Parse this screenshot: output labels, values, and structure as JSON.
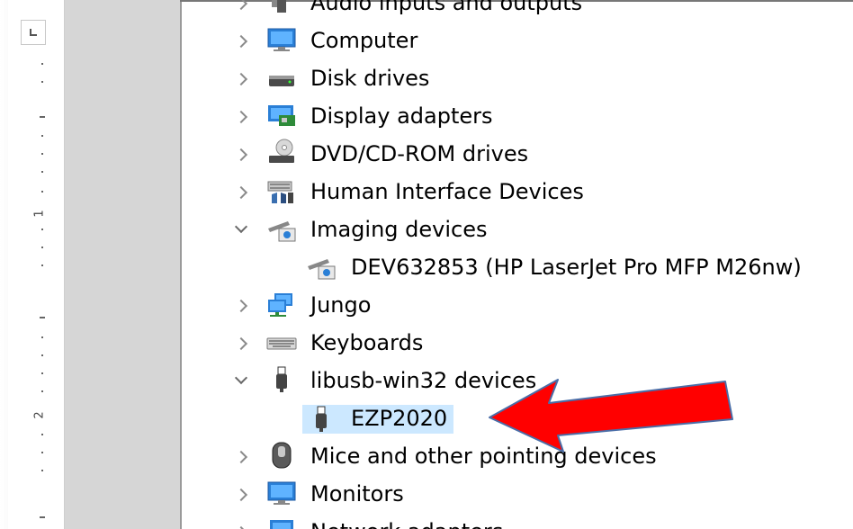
{
  "device_tree": {
    "items": [
      {
        "label": "Audio inputs and outputs",
        "expanded": false,
        "icon": "speaker-icon"
      },
      {
        "label": "Computer",
        "expanded": false,
        "icon": "monitor-icon"
      },
      {
        "label": "Disk drives",
        "expanded": false,
        "icon": "disk-drive-icon"
      },
      {
        "label": "Display adapters",
        "expanded": false,
        "icon": "display-adapter-icon"
      },
      {
        "label": "DVD/CD-ROM drives",
        "expanded": false,
        "icon": "dvd-drive-icon"
      },
      {
        "label": "Human Interface Devices",
        "expanded": false,
        "icon": "hid-icon"
      },
      {
        "label": "Imaging devices",
        "expanded": true,
        "icon": "camera-icon"
      },
      {
        "label": "DEV632853 (HP LaserJet Pro MFP M26nw)",
        "child": true,
        "icon": "camera-icon"
      },
      {
        "label": "Jungo",
        "expanded": false,
        "icon": "network-monitors-icon"
      },
      {
        "label": "Keyboards",
        "expanded": false,
        "icon": "keyboard-icon"
      },
      {
        "label": "libusb-win32 devices",
        "expanded": true,
        "icon": "usb-plug-icon"
      },
      {
        "label": "EZP2020",
        "child": true,
        "selected": true,
        "icon": "usb-plug-icon"
      },
      {
        "label": "Mice and other pointing devices",
        "expanded": false,
        "icon": "mouse-icon"
      },
      {
        "label": "Monitors",
        "expanded": false,
        "icon": "monitor-icon"
      },
      {
        "label": "Network adapters",
        "expanded": false,
        "icon": "network-adapter-icon"
      }
    ]
  },
  "ruler": {
    "numbers": [
      "1",
      "2"
    ]
  },
  "colors": {
    "selection": "#cce8ff",
    "arrow": "#ff0000",
    "arrow_outline": "#4a6da7"
  }
}
